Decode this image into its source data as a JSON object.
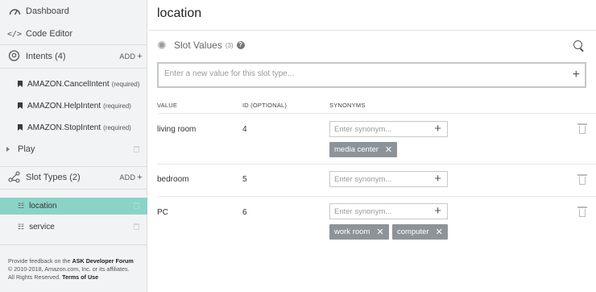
{
  "sidebar": {
    "dashboard": "Dashboard",
    "code_editor": "Code Editor",
    "intents_label": "Intents (4)",
    "intents_add": "ADD",
    "intents": [
      {
        "name": "AMAZON.CancelIntent",
        "tag": "(required)"
      },
      {
        "name": "AMAZON.HelpIntent",
        "tag": "(required)"
      },
      {
        "name": "AMAZON.StopIntent",
        "tag": "(required)"
      }
    ],
    "play": "Play",
    "slot_types_label": "Slot Types (2)",
    "slot_types_add": "ADD",
    "slot_types": [
      {
        "name": "location",
        "active": true
      },
      {
        "name": "service",
        "active": false
      }
    ],
    "footer": {
      "line1_prefix": "Provide feedback on the",
      "line1_link": "ASK Developer Forum",
      "line2": "© 2010-2018, Amazon.com, Inc. or its affiliates.",
      "line3_prefix": "All Rights Reserved.",
      "line3_link": "Terms of Use"
    }
  },
  "main": {
    "title": "location",
    "slot_values_label": "Slot Values",
    "slot_values_count": "(3)",
    "new_value_placeholder": "Enter a new value for this slot type...",
    "columns": {
      "value": "VALUE",
      "id": "ID (OPTIONAL)",
      "synonyms": "SYNONYMS"
    },
    "synonym_placeholder": "Enter synonym...",
    "rows": [
      {
        "value": "living room",
        "id": "4",
        "synonyms": [
          "media center"
        ]
      },
      {
        "value": "bedroom",
        "id": "5",
        "synonyms": []
      },
      {
        "value": "PC",
        "id": "6",
        "synonyms": [
          "work room",
          "computer"
        ]
      }
    ]
  },
  "icons": [
    "gauge-icon",
    "code-icon",
    "intent-head-icon",
    "bookmark-icon",
    "slot-types-icon",
    "list-icon",
    "gear-icon",
    "help-icon",
    "search-icon",
    "plus-icon",
    "close-icon",
    "trash-icon"
  ],
  "colors": {
    "active_row": "#8ad3c7",
    "chip": "#8d9499",
    "sidebar_bg": "#f2f3f4"
  }
}
